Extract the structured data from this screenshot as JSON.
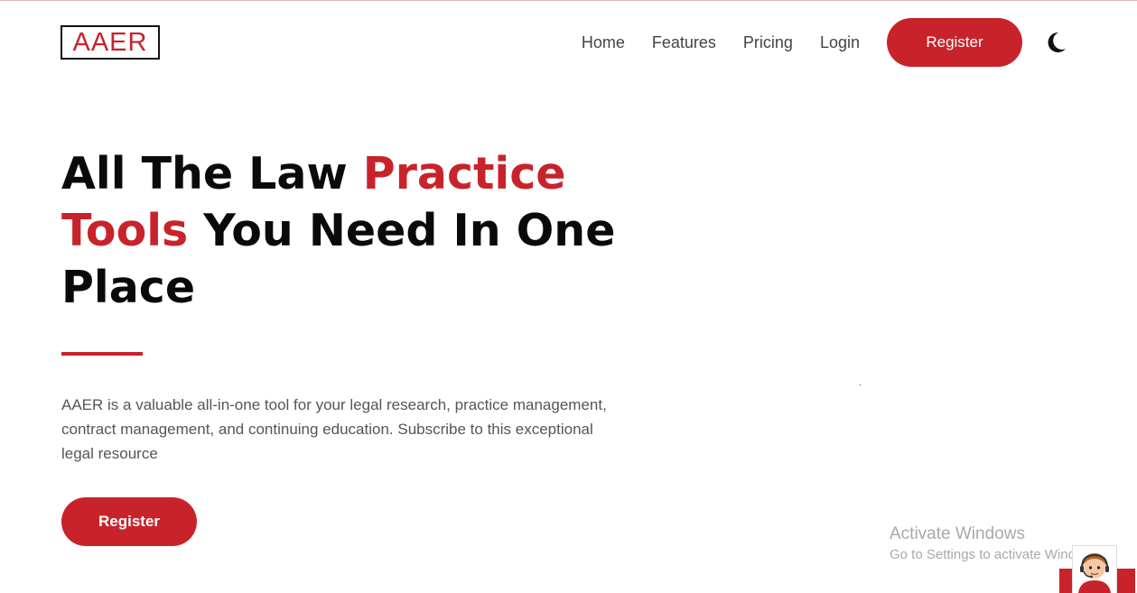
{
  "brand": {
    "logo_text": "AAER",
    "accent_color": "#c8232b"
  },
  "nav": {
    "links": [
      "Home",
      "Features",
      "Pricing",
      "Login"
    ],
    "register_label": "Register",
    "theme_toggle_icon": "moon-icon"
  },
  "hero": {
    "title_part1": "All The Law ",
    "title_highlight": "Practice Tools",
    "title_part2": " You Need In One Place",
    "description": "AAER is a valuable all-in-one tool for your legal research, practice management, contract management, and continuing education. Subscribe to this exceptional legal resource",
    "register_label": "Register"
  },
  "windows_watermark": {
    "title": "Activate Windows",
    "subtitle": "Go to Settings to activate Windows."
  },
  "chat_widget": {
    "icon": "support-agent-icon"
  }
}
